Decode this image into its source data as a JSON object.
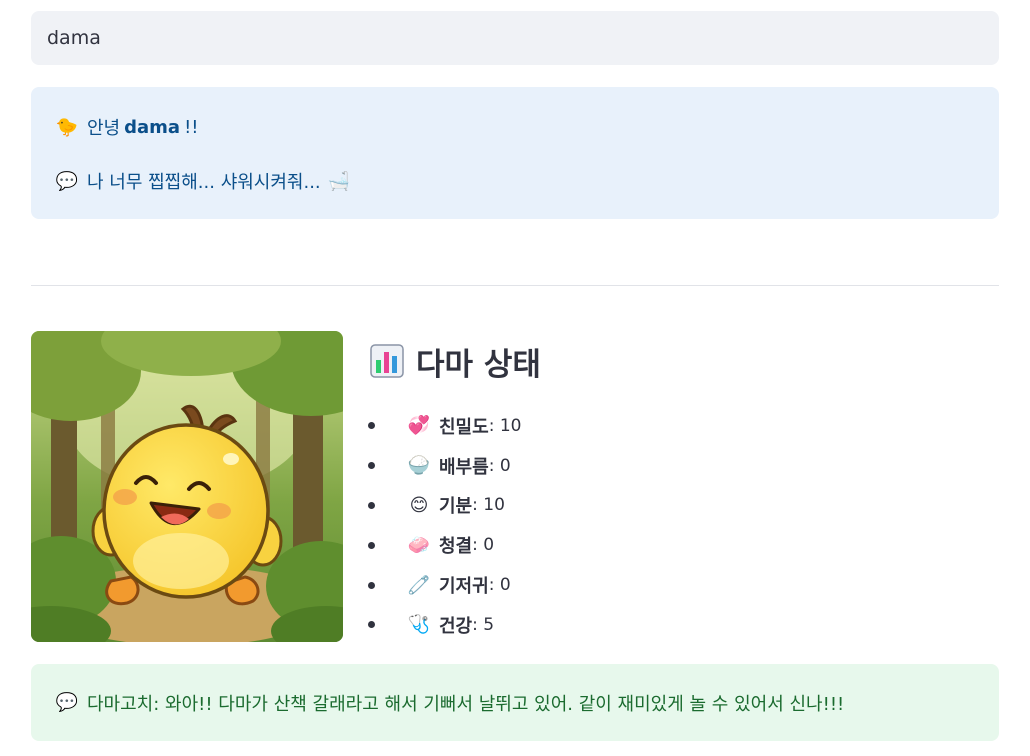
{
  "name_input": {
    "value": "dama"
  },
  "greeting": {
    "icon": "🐤",
    "prefix": "안녕",
    "name": "dama",
    "suffix": "!!"
  },
  "request": {
    "icon": "💬",
    "text": "나 너무 찝찝해... 샤워시켜줘...",
    "trailing_icon": "🛁"
  },
  "pet_image": {
    "description_icon": "yellow-chick-in-forest"
  },
  "status": {
    "title_icon": "📊",
    "title": "다마 상태",
    "items": [
      {
        "icon": "💞",
        "label": "친밀도",
        "value": ": 10"
      },
      {
        "icon": "🍚",
        "label": "배부름",
        "value": ": 0"
      },
      {
        "icon": "😊",
        "label": "기분",
        "value": ": 10"
      },
      {
        "icon": "🧼",
        "label": "청결",
        "value": ": 0"
      },
      {
        "icon": "🧷",
        "label": "기저귀",
        "value": ": 0"
      },
      {
        "icon": "🩺",
        "label": "건강",
        "value": ": 5"
      }
    ]
  },
  "chat": {
    "icon": "💬",
    "text": "다마고치: 와아!! 다마가 산책 갈래라고 해서 기뻐서 날뛰고 있어. 같이 재미있게 놀 수 있어서 신나!!!"
  },
  "colors": {
    "info_bg": "#e8f1fb",
    "info_text": "#0b4f8a",
    "chat_bg": "#e7f8ec",
    "chat_text": "#1b6b2f",
    "input_bg": "#f0f2f6"
  }
}
